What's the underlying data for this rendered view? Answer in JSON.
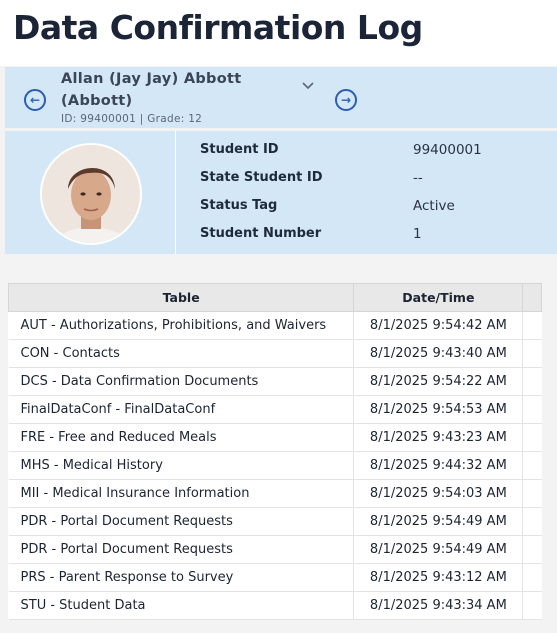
{
  "page": {
    "title": "Data Confirmation Log"
  },
  "student": {
    "name": "Allan (Jay Jay) Abbott (Abbott)",
    "meta": "ID: 99400001 |  Grade: 12",
    "prev_icon": "arrow-left-circle-icon",
    "next_icon": "arrow-right-circle-icon",
    "dropdown_icon": "chevron-down-icon"
  },
  "details": {
    "fields": [
      {
        "label": "Student ID",
        "value": "99400001"
      },
      {
        "label": "State Student ID",
        "value": "--"
      },
      {
        "label": "Status Tag",
        "value": "Active"
      },
      {
        "label": "Student Number",
        "value": "1"
      }
    ]
  },
  "log_table": {
    "headers": [
      "Table",
      "Date/Time"
    ],
    "rows": [
      {
        "table": "AUT - Authorizations, Prohibitions, and Waivers",
        "datetime": "8/1/2025 9:54:42 AM"
      },
      {
        "table": "CON - Contacts",
        "datetime": "8/1/2025 9:43:40 AM"
      },
      {
        "table": "DCS - Data Confirmation Documents",
        "datetime": "8/1/2025 9:54:22 AM"
      },
      {
        "table": "FinalDataConf - FinalDataConf",
        "datetime": "8/1/2025 9:54:53 AM"
      },
      {
        "table": "FRE - Free and Reduced Meals",
        "datetime": "8/1/2025 9:43:23 AM"
      },
      {
        "table": "MHS - Medical History",
        "datetime": "8/1/2025 9:44:32 AM"
      },
      {
        "table": "MII - Medical Insurance Information",
        "datetime": "8/1/2025 9:54:03 AM"
      },
      {
        "table": "PDR - Portal Document Requests",
        "datetime": "8/1/2025 9:54:49 AM"
      },
      {
        "table": "PDR - Portal Document Requests",
        "datetime": "8/1/2025 9:54:49 AM"
      },
      {
        "table": "PRS - Parent Response to Survey",
        "datetime": "8/1/2025 9:43:12 AM"
      },
      {
        "table": "STU - Student Data",
        "datetime": "8/1/2025 9:43:34 AM"
      }
    ]
  },
  "colors": {
    "accent": "#2b5db0",
    "panel": "#d3e7f7",
    "header": "#e8e8e8"
  }
}
